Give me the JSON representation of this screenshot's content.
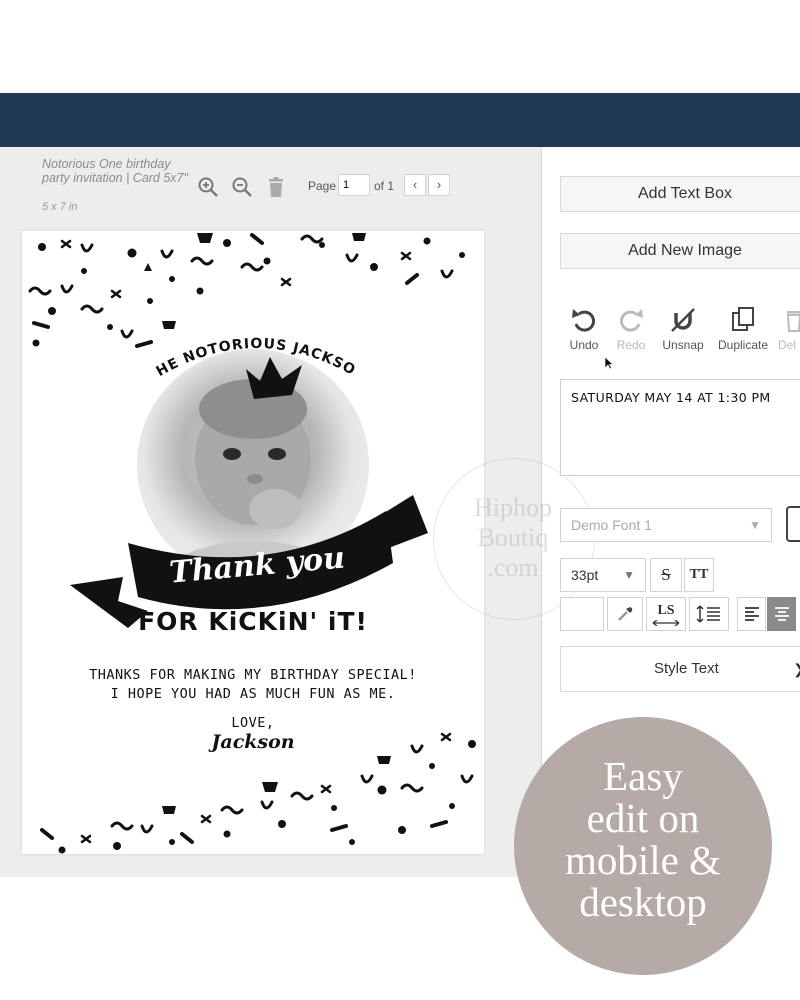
{
  "document": {
    "title": "Notorious One birthday party invitation | Card 5x7\"",
    "size": "5 x 7 in"
  },
  "toolbar": {
    "page_label": "Page",
    "page_value": "1",
    "page_of": "of 1",
    "prev_glyph": "‹",
    "next_glyph": "›"
  },
  "card": {
    "arc_title": "THE NOTORIOUS JACKSON",
    "banner_text": "Thank you",
    "headline": "FOR KiCKiN' iT!",
    "message_line1": "THANKS FOR MAKING MY BIRTHDAY SPECIAL!",
    "message_line2": "I HOPE YOU HAD AS MUCH FUN AS ME.",
    "love": "LOVE,",
    "signature": "Jackson"
  },
  "watermark": {
    "line1": "Hiphop",
    "line2": "Boutiq",
    "line3": ".com"
  },
  "panel": {
    "add_text_box": "Add Text Box",
    "add_new_image": "Add New Image",
    "tools": {
      "undo": "Undo",
      "redo": "Redo",
      "unsnap": "Unsnap",
      "duplicate": "Duplicate",
      "delete": "Del"
    },
    "text_content": "SATURDAY MAY 14 AT 1:30 PM",
    "font_select": "Demo Font 1",
    "size_select": "33pt",
    "strike_glyph": "S",
    "caps_glyph": "TT",
    "letter_spacing_glyph": "LS",
    "style_text": "Style Text"
  },
  "badge": {
    "line1": "Easy",
    "line2": "edit on",
    "line3": "mobile &",
    "line4": "desktop"
  },
  "colors": {
    "topbar": "#1f3a52",
    "badge": "#b5aaa6",
    "workspace": "#ededed"
  },
  "icons": [
    "zoom-in-icon",
    "zoom-out-icon",
    "trash-icon",
    "undo-icon",
    "redo-icon",
    "unsnap-icon",
    "duplicate-icon",
    "delete-icon",
    "eyedropper-icon",
    "line-height-icon",
    "align-left-icon",
    "align-center-icon",
    "cursor-icon"
  ]
}
